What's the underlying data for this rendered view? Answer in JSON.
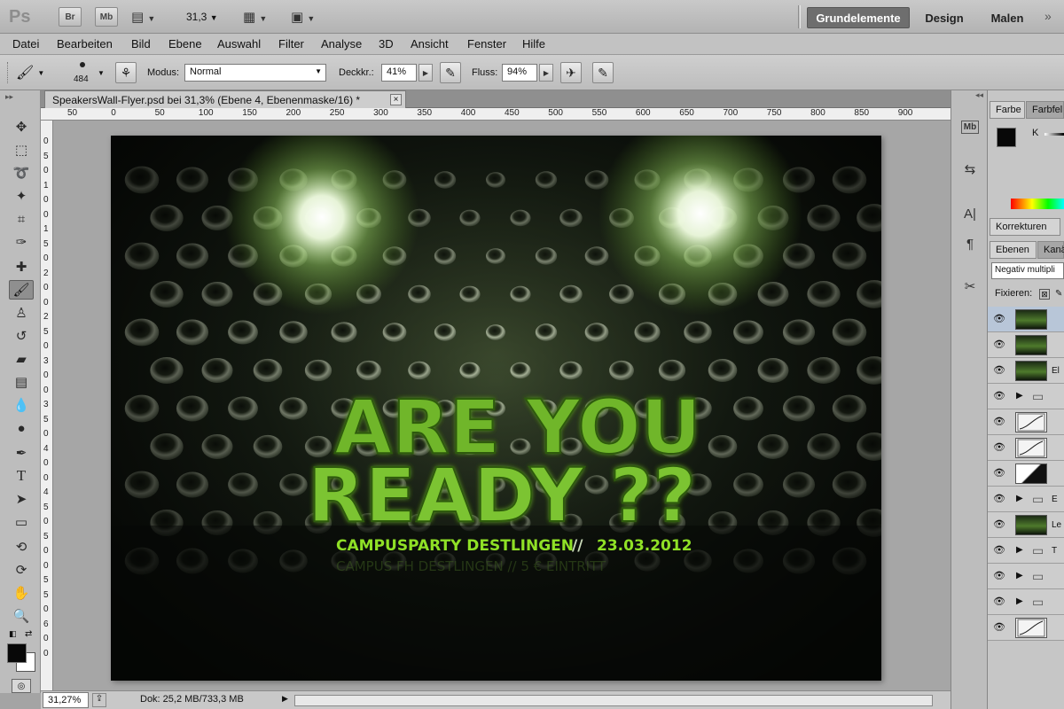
{
  "app": {
    "logo": "Ps",
    "bridge_button": "Br",
    "minibridge_button": "Mb",
    "zoom_value": "31,3",
    "workspaces": [
      {
        "label": "Grundelemente",
        "active": true
      },
      {
        "label": "Design",
        "active": false
      },
      {
        "label": "Malen",
        "active": false
      }
    ]
  },
  "menu": [
    "Datei",
    "Bearbeiten",
    "Bild",
    "Ebene",
    "Auswahl",
    "Filter",
    "Analyse",
    "3D",
    "Ansicht",
    "Fenster",
    "Hilfe"
  ],
  "options": {
    "brush_size": "484",
    "mode_label": "Modus:",
    "mode_value": "Normal",
    "opacity_label": "Deckkr.:",
    "opacity_value": "41%",
    "flow_label": "Fluss:",
    "flow_value": "94%"
  },
  "document": {
    "tab_title": "SpeakersWall-Flyer.psd bei 31,3% (Ebene 4, Ebenenmaske/16) *",
    "close_glyph": "×",
    "ruler_h": [
      "50",
      "0",
      "50",
      "100",
      "150",
      "200",
      "250",
      "300",
      "350",
      "400",
      "450",
      "500",
      "550",
      "600",
      "650",
      "700",
      "750",
      "800",
      "850",
      "900"
    ],
    "ruler_v": [
      "0",
      "5",
      "0",
      "1",
      "0",
      "0",
      "1",
      "5",
      "0",
      "2",
      "0",
      "0",
      "2",
      "5",
      "0",
      "3",
      "0",
      "0",
      "3",
      "5",
      "0",
      "4",
      "0",
      "0",
      "4",
      "5",
      "0",
      "5",
      "0",
      "0",
      "5",
      "5",
      "0",
      "6",
      "0",
      "0"
    ]
  },
  "artwork": {
    "headline_1": "ARE YOU",
    "headline_2": "READY ??",
    "event_name": "CAMPUSPARTY DESTLINGEN",
    "separator": "//",
    "event_date": "23.03.2012",
    "sub_line": "CAMPUS FH DESTLINGEN  //  5 € EINTRITT",
    "accent_color": "#8fe026"
  },
  "status": {
    "zoom": "31,27%",
    "doc_info": "Dok: 25,2 MB/733,3 MB"
  },
  "panels": {
    "color_tab": "Farbe",
    "swatches_tab": "Farbfel",
    "color_channel": "K",
    "adjustments_tab": "Korrekturen",
    "layers_tab": "Ebenen",
    "channels_tab": "Kanä",
    "blend_mode": "Negativ multipli",
    "lock_label": "Fixieren:",
    "layers": [
      {
        "name": "",
        "kind": "image",
        "selected": true
      },
      {
        "name": "",
        "kind": "image",
        "selected": false
      },
      {
        "name": "El",
        "kind": "image",
        "selected": false
      },
      {
        "name": "",
        "kind": "group",
        "selected": false
      },
      {
        "name": "",
        "kind": "curves",
        "selected": false
      },
      {
        "name": "",
        "kind": "curves",
        "selected": false
      },
      {
        "name": "",
        "kind": "levels",
        "selected": false
      },
      {
        "name": "E",
        "kind": "group",
        "selected": false
      },
      {
        "name": "Le",
        "kind": "image",
        "selected": false
      },
      {
        "name": "T",
        "kind": "group",
        "selected": false
      },
      {
        "name": "",
        "kind": "group",
        "selected": false
      },
      {
        "name": "",
        "kind": "group",
        "selected": false
      },
      {
        "name": "",
        "kind": "curves",
        "selected": false
      }
    ]
  }
}
